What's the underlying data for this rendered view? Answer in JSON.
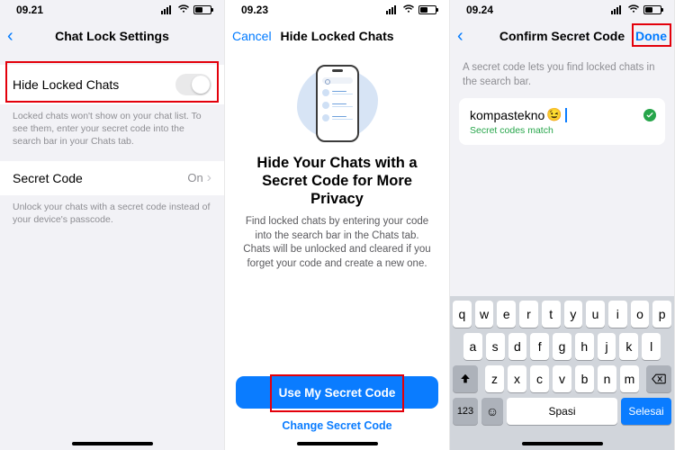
{
  "screens": {
    "s1": {
      "time": "09.21",
      "nav_title": "Chat Lock Settings",
      "row_toggle_label": "Hide Locked Chats",
      "toggle_help": "Locked chats won't show on your chat list. To see them, enter your secret code into the search bar in your Chats tab.",
      "row_code_label": "Secret Code",
      "row_code_value": "On",
      "code_help": "Unlock your chats with a secret code instead of your device's passcode."
    },
    "s2": {
      "time": "09.23",
      "cancel": "Cancel",
      "nav_title": "Hide Locked Chats",
      "headline": "Hide Your Chats with a Secret Code for More Privacy",
      "body": "Find locked chats by entering your code into the search bar in the Chats tab. Chats will be unlocked and cleared if you forget your code and create a new one.",
      "primary": "Use My Secret Code",
      "secondary": "Change Secret Code"
    },
    "s3": {
      "time": "09.24",
      "nav_title": "Confirm Secret Code",
      "done": "Done",
      "note": "A secret code lets you find locked chats in the search bar.",
      "code_value": "kompastekno",
      "code_emoji": "😉",
      "match_text": "Secret codes match",
      "keyboard": {
        "rows": [
          [
            "q",
            "w",
            "e",
            "r",
            "t",
            "y",
            "u",
            "i",
            "o",
            "p"
          ],
          [
            "a",
            "s",
            "d",
            "f",
            "g",
            "h",
            "j",
            "k",
            "l"
          ],
          [
            "z",
            "x",
            "c",
            "v",
            "b",
            "n",
            "m"
          ]
        ],
        "num": "123",
        "space": "Spasi",
        "done": "Selesai"
      }
    }
  }
}
